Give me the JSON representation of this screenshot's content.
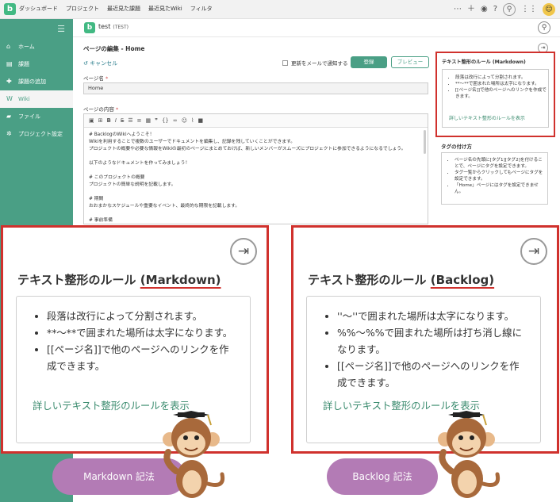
{
  "topbar": {
    "nav": [
      "ダッシュボード",
      "プロジェクト",
      "最近見た課題",
      "最近見たWiki",
      "フィルタ"
    ],
    "logo_letter": "b",
    "icons": [
      "more-icon",
      "plus-icon",
      "eye-icon",
      "question-icon",
      "search-icon",
      "apps-icon",
      "avatar"
    ]
  },
  "sidebar": {
    "items": [
      {
        "label": "ホーム",
        "icon": "home-icon"
      },
      {
        "label": "課題",
        "icon": "issues-icon"
      },
      {
        "label": "課題の追加",
        "icon": "plus-icon"
      },
      {
        "label": "Wiki",
        "icon": "wiki-icon"
      },
      {
        "label": "ファイル",
        "icon": "folder-icon"
      },
      {
        "label": "プロジェクト設定",
        "icon": "gear-icon"
      }
    ],
    "active_index": 3
  },
  "project": {
    "logo_letter": "b",
    "name": "test",
    "key": "(TEST)"
  },
  "edit": {
    "title": "ページの編集 - Home",
    "cancel": "キャンセル",
    "notify_label": "更新をメールで通知する",
    "save": "登録",
    "preview": "プレビュー",
    "name_label": "ページ名",
    "name_value": "Home",
    "content_label": "ページの内容",
    "required_mark": "*",
    "content_lines": [
      "# BacklogのWikiへようこそ！",
      "Wikiを利用することで複数のユーザーでドキュメントを編集し、記録を残していくことができます。",
      "プロジェクトの概要や必要な情報をWikiの最初のページにまとめておけば、新しいメンバーがスムーズにプロジェクトに参加できるようになるでしょう。",
      "",
      "以下のようなドキュメントを作ってみましょう！",
      "",
      "# このプロジェクトの概要",
      "プロジェクトの簡単な説明を記載します。",
      "",
      "# 期間",
      "おおまかなスケジュールや重要なイベント、最終的な期限を記載します。",
      "",
      "# 事前準備"
    ]
  },
  "rules_small": {
    "title": "テキスト整形のルール (Markdown)",
    "items": [
      "段落は改行によって分割されます。",
      "**〜**で囲まれた場所は太字になります。",
      "[[ページ名]]で他のページへのリンクを作成できます。"
    ],
    "link": "詳しいテキスト整形のルールを表示"
  },
  "tags": {
    "title": "タグの付け方",
    "items": [
      "ページ名の先頭に[タグ1][タグ2]を付けることで、ページにタグを設定できます。",
      "タグ一覧からクリックしてもページにタグを設定できます。",
      "「Home」ページにはタグを設定できません。"
    ]
  },
  "callouts": [
    {
      "title_prefix": "テキスト整形のルール ",
      "title_mode": "(Markdown)",
      "items": [
        "段落は改行によって分割されます。",
        "**〜**で囲まれた場所は太字になります。",
        "[[ページ名]]で他のページへのリンクを作成できます。"
      ],
      "link": "詳しいテキスト整形のルールを表示",
      "badge": "Markdown 記法"
    },
    {
      "title_prefix": "テキスト整形のルール ",
      "title_mode": "(Backlog)",
      "items": [
        "''〜''で囲まれた場所は太字になります。",
        "%%〜%%で囲まれた場所は打ち消し線になります。",
        "[[ページ名]]で他のページへのリンクを作成できます。"
      ],
      "link": "詳しいテキスト整形のルールを表示",
      "badge": "Backlog 記法"
    }
  ],
  "colors": {
    "brand": "#4a9f85",
    "highlight": "#d0312d",
    "badge": "#b37bb5",
    "link": "#3a8b6e"
  }
}
